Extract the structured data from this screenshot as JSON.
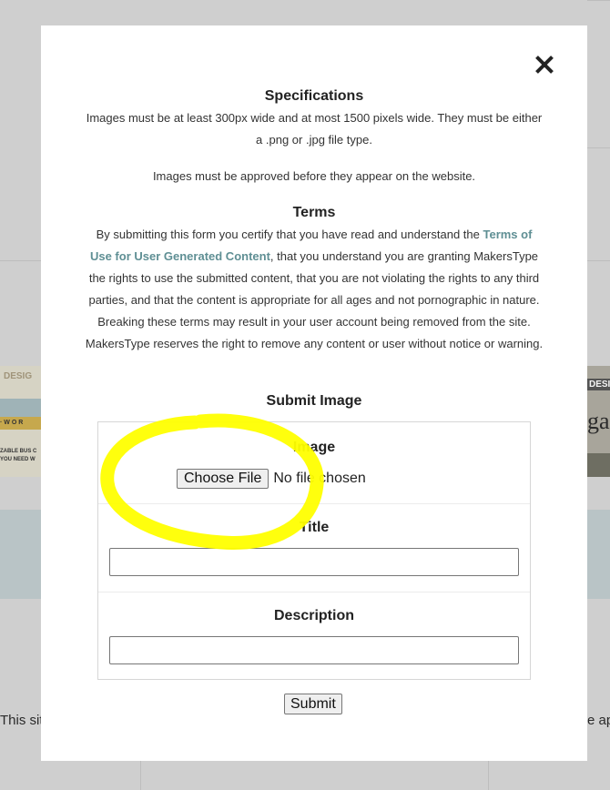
{
  "modal": {
    "specifications_heading": "Specifications",
    "specifications_text_1": "Images must be at least 300px wide and at most 1500 pixels wide. They must be either a .png or .jpg file type.",
    "specifications_text_2": "Images must be approved before they appear on the website.",
    "terms_heading": "Terms",
    "terms_text_before_link": "By submitting this form you certify that you have read and understand the ",
    "terms_link": "Terms of Use for User Generated Content",
    "terms_text_after_link": ", that you understand you are granting MakersType the rights to use the submitted content, that you are not violating the rights to any third parties, and that the content is appropriate for all ages and not pornographic in nature. Breaking these terms may result in your user account being removed from the site. MakersType reserves the right to remove any content or user without notice or warning.",
    "submit_heading": "Submit Image",
    "close_icon": "close-icon"
  },
  "form": {
    "image_label": "Image",
    "choose_file_label": "Choose File",
    "file_status": "No file chosen",
    "title_label": "Title",
    "title_value": "",
    "description_label": "Description",
    "description_value": "",
    "submit_label": "Submit"
  },
  "background": {
    "left_text": "This sit",
    "right_text": "e ap",
    "left_thumb_top": "DESIG",
    "left_thumb_band": "· W O R",
    "left_thumb_caption": "ZABLE BUS C YOU NEED W",
    "right_thumb_top": "DESIG",
    "right_thumb_big": "gar"
  },
  "colors": {
    "link": "#5f8f94",
    "highlight": "#ffff00"
  }
}
